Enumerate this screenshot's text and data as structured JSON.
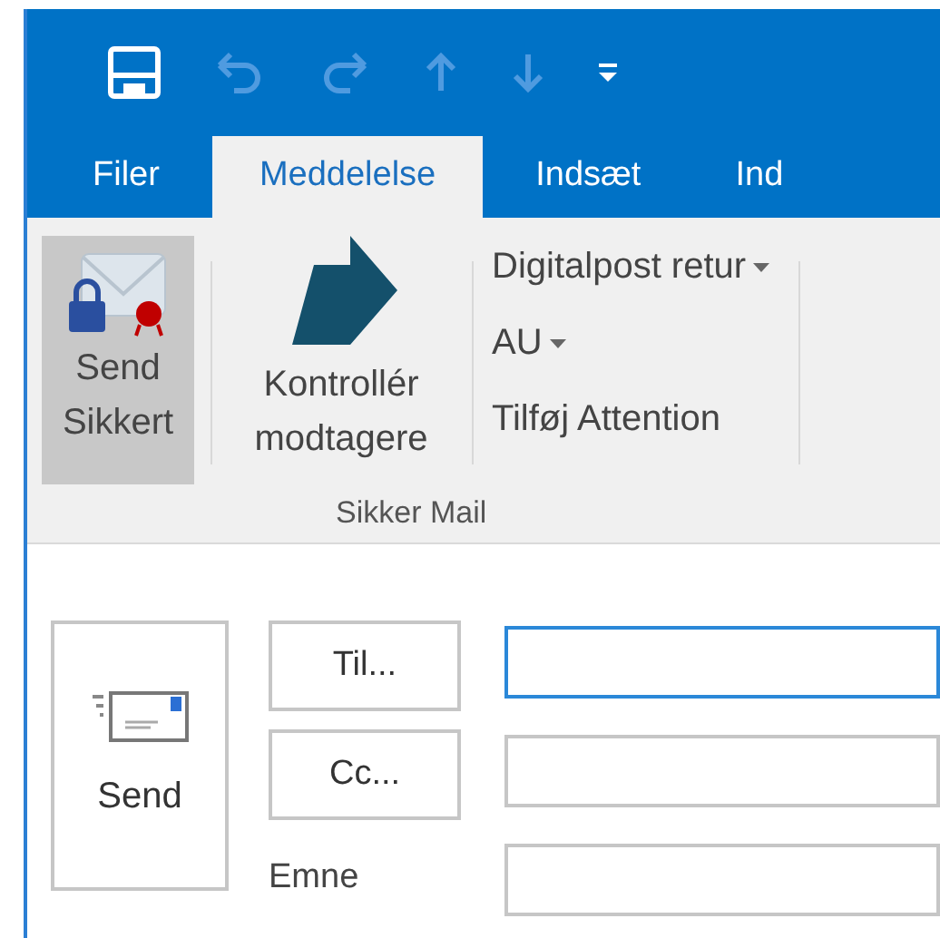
{
  "quick_access": [
    {
      "kind": "save",
      "disabled": false
    },
    {
      "kind": "undo",
      "disabled": true
    },
    {
      "kind": "redo",
      "disabled": true
    },
    {
      "kind": "up",
      "disabled": true
    },
    {
      "kind": "down",
      "disabled": true
    },
    {
      "kind": "customize",
      "disabled": false
    }
  ],
  "tabs": [
    {
      "label": "Filer",
      "selected": false
    },
    {
      "label": "Meddelelse",
      "selected": true
    },
    {
      "label": "Indsæt",
      "selected": false
    },
    {
      "label": "Ind",
      "selected": false
    }
  ],
  "ribbon": {
    "group_label": "Sikker Mail",
    "send_secure": {
      "label": "Send Sikkert",
      "pressed": true
    },
    "check_recipients": {
      "label": "Kontrollér modtagere"
    },
    "items": [
      {
        "label": "Digitalpost retur",
        "dropdown": true
      },
      {
        "label": "AU",
        "dropdown": true
      },
      {
        "label": "Tilføj Attention",
        "dropdown": false
      }
    ]
  },
  "compose": {
    "send": "Send",
    "to": {
      "label": "Til...",
      "focused": true
    },
    "cc": {
      "label": "Cc...",
      "focused": false
    },
    "subject": {
      "label": "Emne",
      "focused": false
    }
  }
}
